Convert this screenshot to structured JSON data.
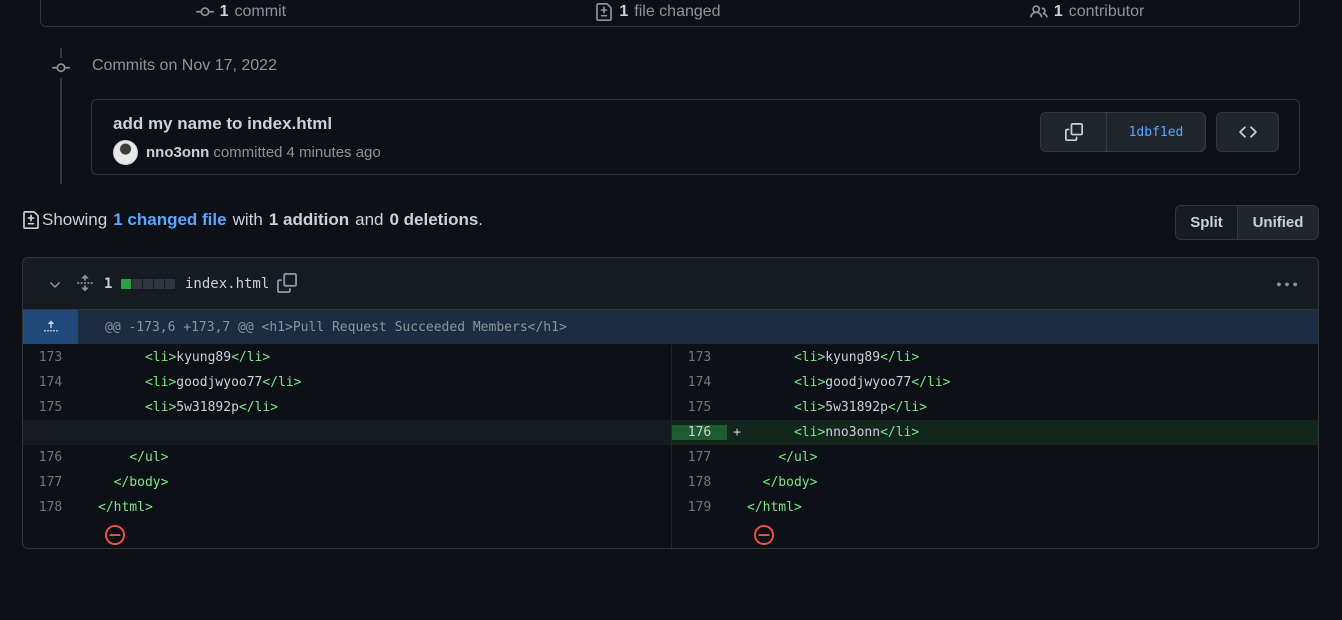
{
  "summary": {
    "commits": {
      "count": "1",
      "label": "commit",
      "icon": "commit-icon"
    },
    "files": {
      "count": "1",
      "label": "file changed",
      "icon": "file-diff-icon"
    },
    "contributors": {
      "count": "1",
      "label": "contributor",
      "icon": "people-icon"
    }
  },
  "timeline": {
    "date_label": "Commits on Nov 17, 2022"
  },
  "commit": {
    "title": "add my name to index.html",
    "author": "nno3onn",
    "action": "committed",
    "time": "4 minutes ago",
    "sha": "1dbf1ed"
  },
  "showing": {
    "prefix": "Showing",
    "changed": "1 changed file",
    "with": "with",
    "additions": "1 addition",
    "and": "and",
    "deletions": "0 deletions",
    "period": "."
  },
  "view_toggle": {
    "split": "Split",
    "unified": "Unified",
    "active": "Unified"
  },
  "file": {
    "change_count": "1",
    "name": "index.html",
    "stat_bars": [
      "add",
      "neutral",
      "neutral",
      "neutral",
      "neutral"
    ],
    "hunk_header": "@@ -173,6 +173,7 @@ <h1>Pull Request Succeeded Members</h1>",
    "colors": {
      "addition": "#2ea043",
      "link": "#58a6ff",
      "tag": "#7ee787"
    },
    "left": [
      {
        "ln": "173",
        "indent": "      ",
        "open": "<li>",
        "text": "kyung89",
        "close": "</li>"
      },
      {
        "ln": "174",
        "indent": "      ",
        "open": "<li>",
        "text": "goodjwyoo77",
        "close": "</li>"
      },
      {
        "ln": "175",
        "indent": "      ",
        "open": "<li>",
        "text": "5w31892p",
        "close": "</li>"
      },
      {
        "ln": "",
        "indent": "",
        "open": "",
        "text": "",
        "close": "",
        "empty": true
      },
      {
        "ln": "176",
        "indent": "    ",
        "open": "</ul>",
        "text": "",
        "close": ""
      },
      {
        "ln": "177",
        "indent": "  ",
        "open": "</body>",
        "text": "",
        "close": ""
      },
      {
        "ln": "178",
        "indent": "",
        "open": "</html>",
        "text": "",
        "close": ""
      }
    ],
    "right": [
      {
        "ln": "173",
        "indent": "      ",
        "open": "<li>",
        "text": "kyung89",
        "close": "</li>"
      },
      {
        "ln": "174",
        "indent": "      ",
        "open": "<li>",
        "text": "goodjwyoo77",
        "close": "</li>"
      },
      {
        "ln": "175",
        "indent": "      ",
        "open": "<li>",
        "text": "5w31892p",
        "close": "</li>"
      },
      {
        "ln": "176",
        "indent": "      ",
        "open": "<li>",
        "text": "nno3onn",
        "close": "</li>",
        "added": true,
        "marker": "+"
      },
      {
        "ln": "177",
        "indent": "    ",
        "open": "</ul>",
        "text": "",
        "close": ""
      },
      {
        "ln": "178",
        "indent": "  ",
        "open": "</body>",
        "text": "",
        "close": ""
      },
      {
        "ln": "179",
        "indent": "",
        "open": "</html>",
        "text": "",
        "close": ""
      }
    ]
  }
}
